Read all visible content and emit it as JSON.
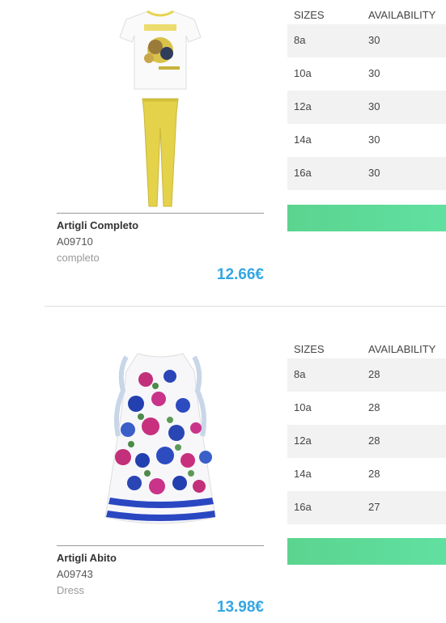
{
  "products": [
    {
      "name": "Artigli Completo",
      "code": "A09710",
      "category": "completo",
      "price": "12.66€",
      "table": {
        "header_size": "SIZES",
        "header_availability": "AVAILABILITY",
        "rows": [
          {
            "size": "8a",
            "availability": "30"
          },
          {
            "size": "10a",
            "availability": "30"
          },
          {
            "size": "12a",
            "availability": "30"
          },
          {
            "size": "14a",
            "availability": "30"
          },
          {
            "size": "16a",
            "availability": "30"
          }
        ]
      }
    },
    {
      "name": "Artigli Abito",
      "code": "A09743",
      "category": "Dress",
      "price": "13.98€",
      "table": {
        "header_size": "SIZES",
        "header_availability": "AVAILABILITY",
        "rows": [
          {
            "size": "8a",
            "availability": "28"
          },
          {
            "size": "10a",
            "availability": "28"
          },
          {
            "size": "12a",
            "availability": "28"
          },
          {
            "size": "14a",
            "availability": "28"
          },
          {
            "size": "16a",
            "availability": "27"
          }
        ]
      }
    }
  ],
  "colors": {
    "price": "#33a6e3",
    "button": "#5bd48f",
    "row_alt": "#f2f2f2"
  }
}
